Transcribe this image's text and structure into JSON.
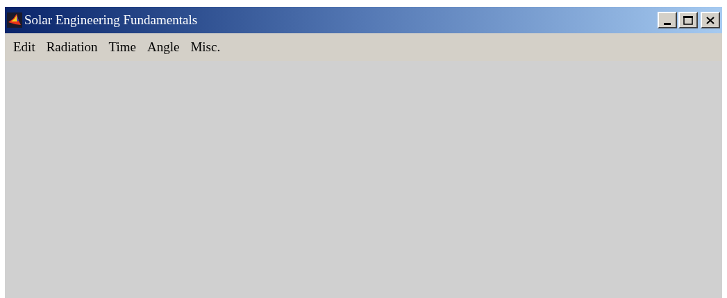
{
  "window": {
    "title": "Solar Engineering Fundamentals"
  },
  "menu": {
    "items": [
      "Edit",
      "Radiation",
      "Time",
      "Angle",
      "Misc."
    ]
  }
}
